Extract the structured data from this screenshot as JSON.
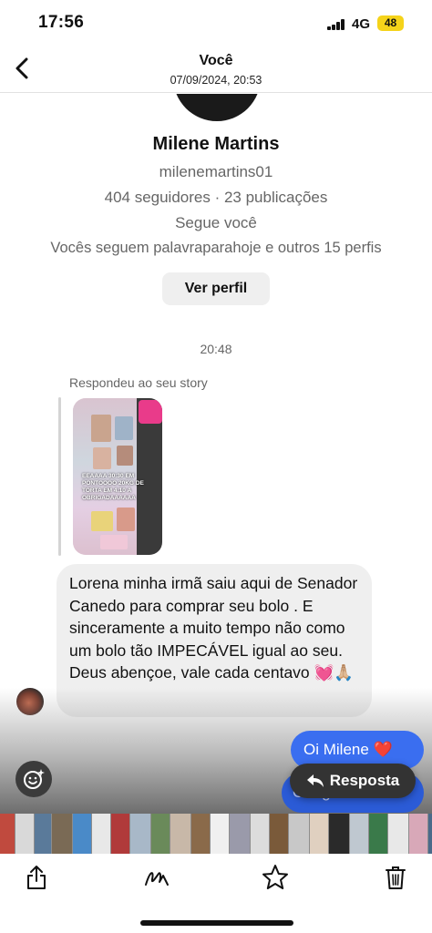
{
  "status_bar": {
    "time": "17:56",
    "network": "4G",
    "battery": "48"
  },
  "header": {
    "title": "Você",
    "subtitle": "07/09/2024, 20:53"
  },
  "profile": {
    "name": "Milene Martins",
    "username": "milenemartins01",
    "stats": "404 seguidores · 23 publicações",
    "follows_you": "Segue você",
    "mutual": "Vocês seguem palavraparahoje e outros 15 perfis",
    "view_profile_label": "Ver perfil"
  },
  "conversation": {
    "timestamp": "20:48",
    "reply_label": "Respondeu ao seu story",
    "story_overlay_text": "Eeaaaa 30:30 em pontoooo 20kg de torta em 4:10 a obrigadaaaaaa",
    "incoming_message": "Lorena minha irmã saiu aqui de Senador Canedo para comprar seu bolo . E sinceramente a muito tempo não como um bolo tão IMPECÁVEL igual ao seu. Deus abençoe,  vale cada centavo 💓🙏🏼",
    "outgoing_message_1": "Oi Milene ❤️",
    "outgoing_message_2": "Obrigadaaaaa"
  },
  "reply_action": {
    "label": "Resposta"
  },
  "colors": {
    "outgoing_bubble": "#3a6ef0",
    "incoming_bubble": "#efefef",
    "battery": "#f5d31a",
    "reply_pill": "#333333"
  },
  "toolbar": {
    "icons": [
      "share-icon",
      "markup-icon",
      "favorite-star-icon",
      "trash-icon"
    ]
  }
}
